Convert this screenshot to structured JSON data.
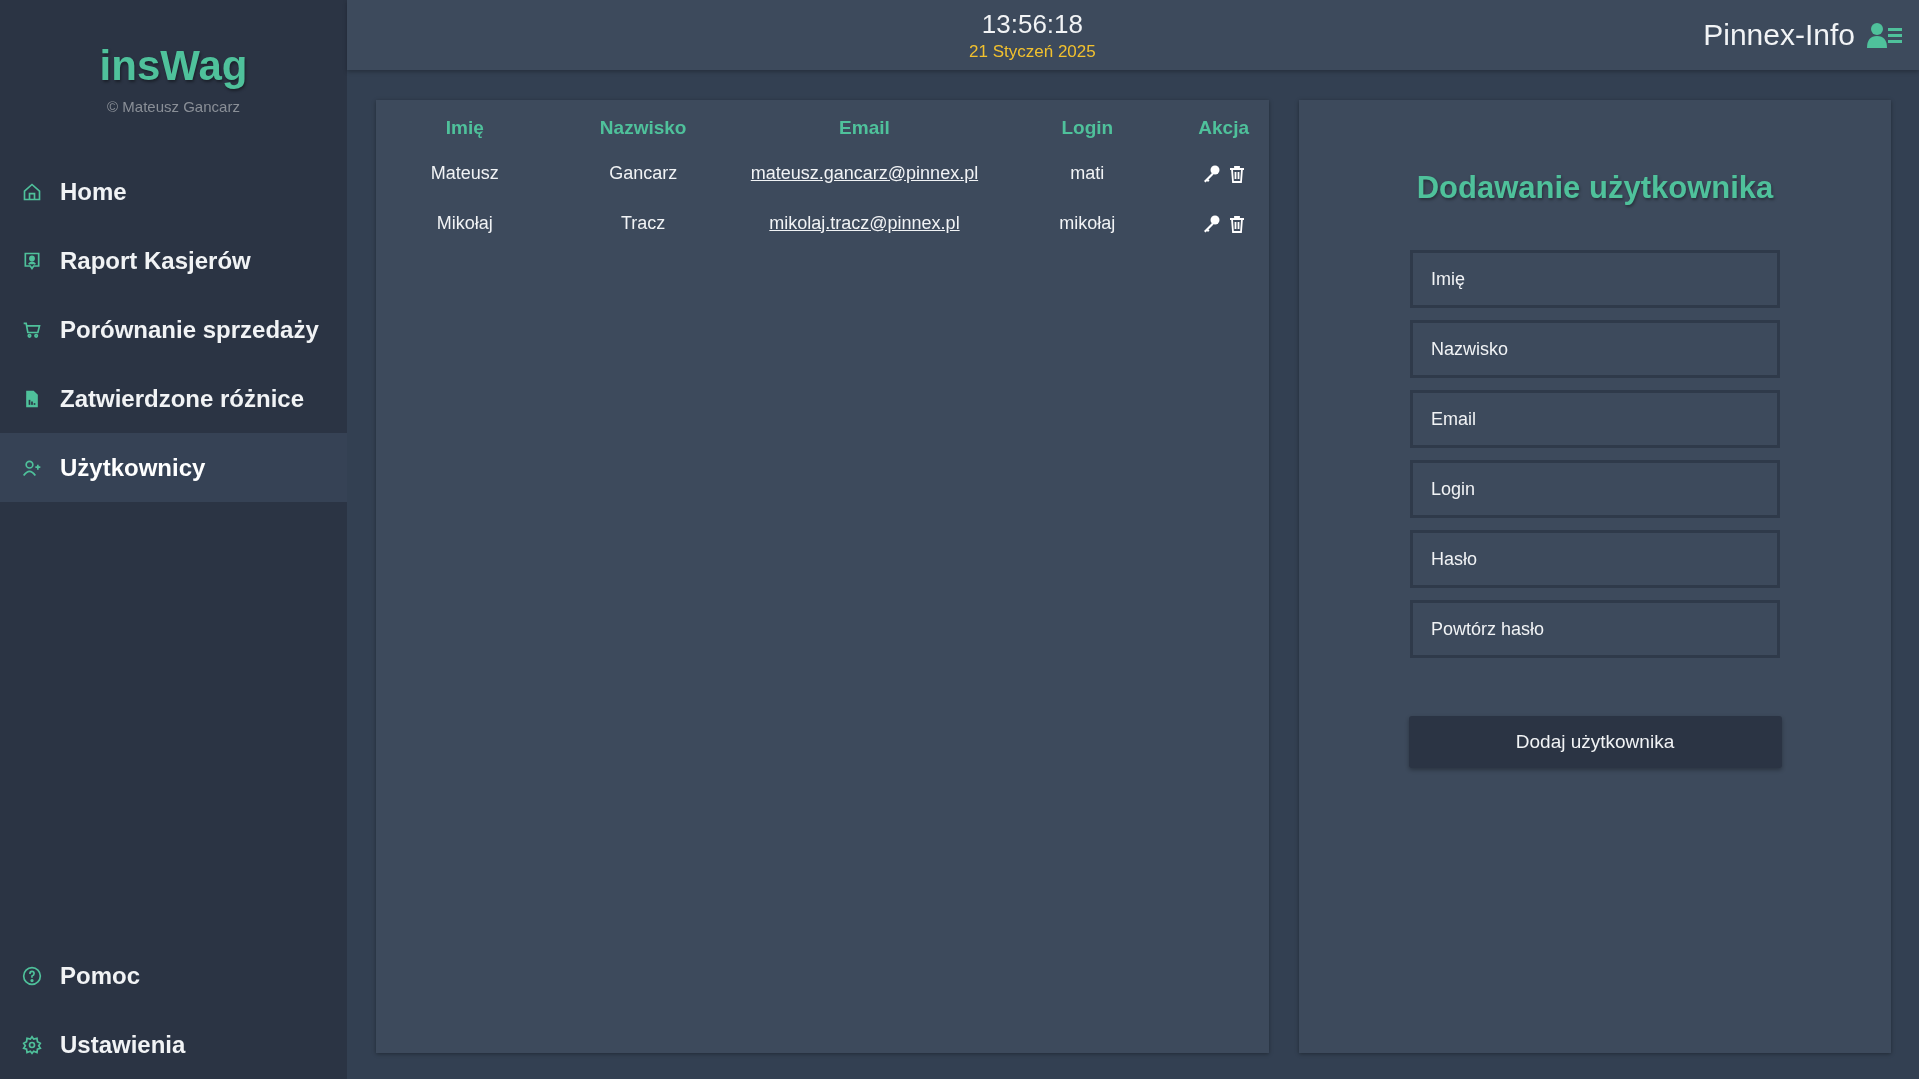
{
  "sidebar": {
    "logo": "insWag",
    "copyright": "© Mateusz Gancarz",
    "items": [
      {
        "label": "Home",
        "selected": false
      },
      {
        "label": "Raport Kasjerów",
        "selected": false
      },
      {
        "label": "Porównanie sprzedaży",
        "selected": false
      },
      {
        "label": "Zatwierdzone różnice",
        "selected": false
      },
      {
        "label": "Użytkownicy",
        "selected": true
      }
    ],
    "bottom_items": [
      {
        "label": "Pomoc",
        "selected": false
      },
      {
        "label": "Ustawienia",
        "selected": false
      }
    ]
  },
  "header": {
    "time": "13:56:18",
    "date": "21 Styczeń 2025",
    "company": "Pinnex-Info"
  },
  "table": {
    "columns": [
      "Imię",
      "Nazwisko",
      "Email",
      "Login",
      "Akcja"
    ],
    "rows": [
      {
        "first_name": "Mateusz",
        "last_name": "Gancarz",
        "email": "mateusz.gancarz@pinnex.pl",
        "login": "mati"
      },
      {
        "first_name": "Mikołaj",
        "last_name": "Tracz",
        "email": "mikolaj.tracz@pinnex.pl",
        "login": "mikołaj"
      }
    ]
  },
  "form": {
    "title": "Dodawanie użytkownika",
    "fields": [
      {
        "placeholder": "Imię"
      },
      {
        "placeholder": "Nazwisko"
      },
      {
        "placeholder": "Email"
      },
      {
        "placeholder": "Login"
      },
      {
        "placeholder": "Hasło"
      },
      {
        "placeholder": "Powtórz hasło"
      }
    ],
    "submit": "Dodaj użytkownika"
  }
}
